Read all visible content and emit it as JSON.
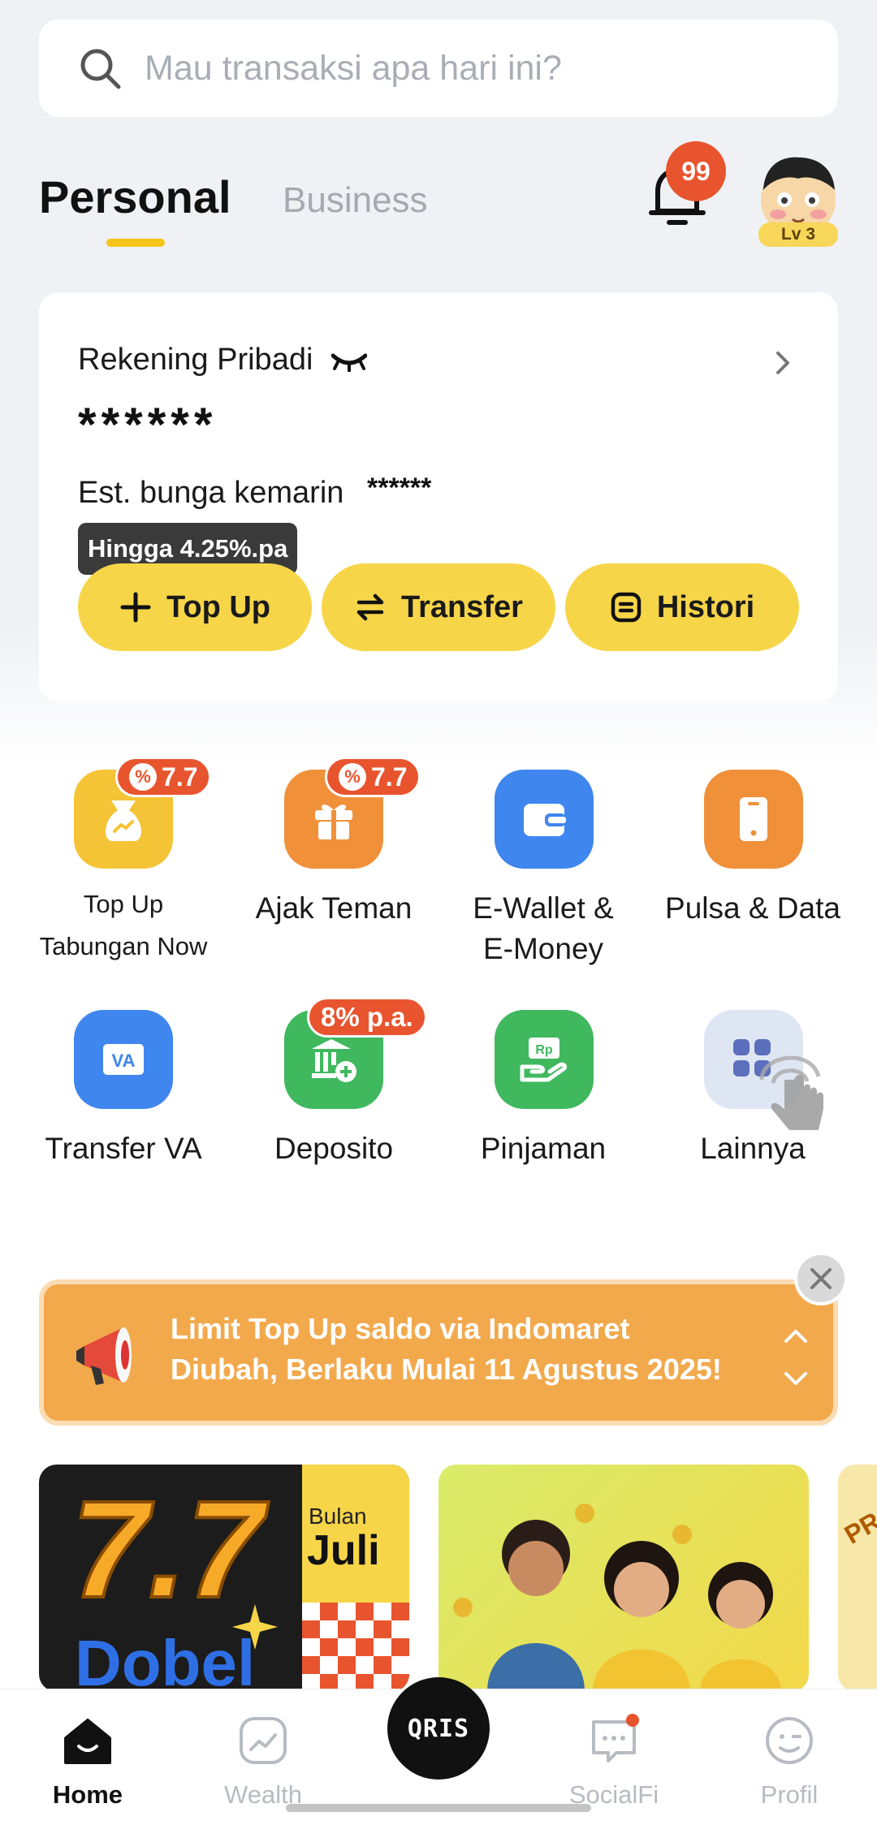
{
  "search": {
    "placeholder": "Mau transaksi apa hari ini?"
  },
  "tabs": {
    "personal": "Personal",
    "business": "Business"
  },
  "notifications": {
    "count": "99"
  },
  "profile": {
    "level": "Lv 3"
  },
  "account": {
    "title": "Rekening Pribadi",
    "balance": "******",
    "interest_label": "Est. bunga kemarin",
    "interest_value": "******",
    "rate_tag": "Hingga 4.25%.pa",
    "actions": [
      {
        "label": "Top Up",
        "icon": "plus-icon"
      },
      {
        "label": "Transfer",
        "icon": "swap-arrows-icon"
      },
      {
        "label": "Histori",
        "icon": "history-icon"
      }
    ]
  },
  "menu": [
    {
      "line1": "Top Up",
      "line2": "Tabungan Now",
      "badge": "7.7",
      "color": "#f5c436"
    },
    {
      "label": "Ajak Teman",
      "badge": "7.7",
      "color": "#f0913a"
    },
    {
      "line1": "E-Wallet &",
      "line2": "E-Money",
      "color": "#3f86ee"
    },
    {
      "label": "Pulsa & Data",
      "color": "#f0913a"
    },
    {
      "label": "Transfer VA",
      "color": "#3f86ee"
    },
    {
      "label": "Deposito",
      "badge": "8% p.a.",
      "color": "#3fb85e"
    },
    {
      "label": "Pinjaman",
      "color": "#3fb85e"
    },
    {
      "label": "Lainnya",
      "color": "#dfe6f3"
    }
  ],
  "announcement": {
    "line1": "Limit Top Up saldo via Indomaret",
    "line2": "Diubah, Berlaku Mulai 11 Agustus 2025!"
  },
  "banners": {
    "promo1_big": "7.7",
    "promo1_word": "Dobel",
    "promo1_small": "Bulan",
    "promo1_month": "Juli",
    "promo3_text": "PR"
  },
  "nav": {
    "home": "Home",
    "wealth": "Wealth",
    "qris": "QRIS",
    "socialfi": "SocialFi",
    "profil": "Profil"
  },
  "colors": {
    "accent": "#f7d548",
    "badge": "#e8542e",
    "announce": "#f2a94c"
  }
}
